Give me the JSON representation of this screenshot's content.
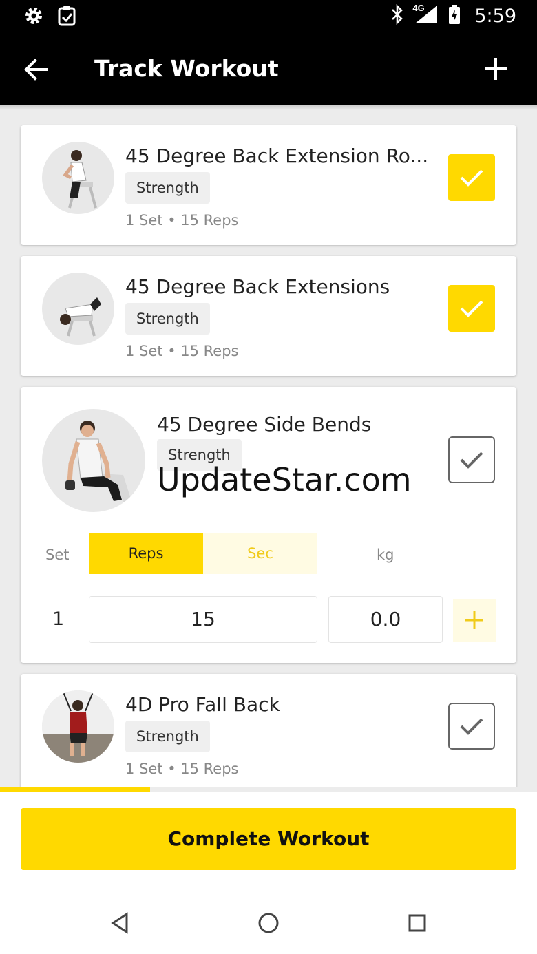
{
  "status_bar": {
    "time": "5:59",
    "network": "4G"
  },
  "app_bar": {
    "title": "Track Workout"
  },
  "exercises": [
    {
      "name": "45 Degree Back Extension Ro...",
      "tag": "Strength",
      "meta": "1 Set • 15 Reps",
      "completed": true
    },
    {
      "name": "45 Degree Back Extensions",
      "tag": "Strength",
      "meta": "1 Set • 15 Reps",
      "completed": true
    },
    {
      "name": "45 Degree Side Bends",
      "tag": "Strength",
      "completed": false
    },
    {
      "name": "4D Pro Fall Back",
      "tag": "Strength",
      "meta": "1 Set • 15 Reps",
      "completed": false
    }
  ],
  "watermark": "UpdateStar.com",
  "expanded": {
    "set_label": "Set",
    "reps_label": "Reps",
    "sec_label": "Sec",
    "kg_label": "kg",
    "rows": [
      {
        "set": "1",
        "reps": "15",
        "kg": "0.0"
      }
    ]
  },
  "progress": 0.28,
  "complete_button": "Complete Workout",
  "colors": {
    "accent": "#ffd900",
    "accent_light": "#fffbe3",
    "app_bar": "#000000"
  }
}
